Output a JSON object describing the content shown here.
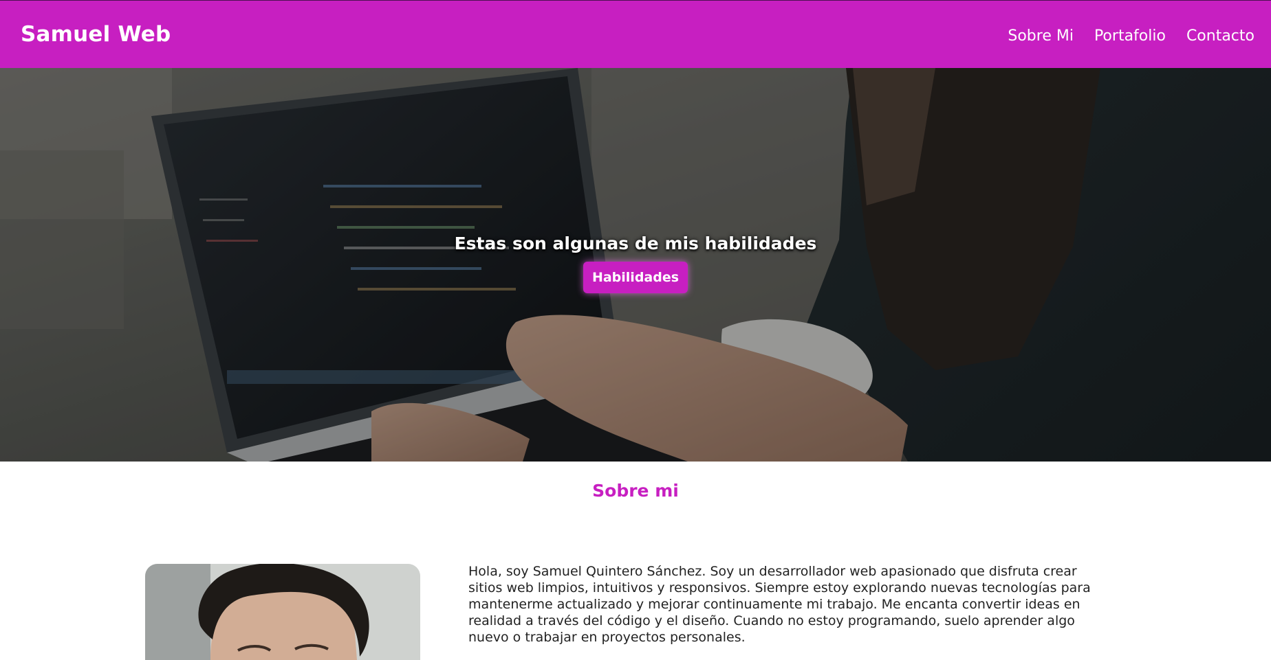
{
  "header": {
    "brand": "Samuel Web",
    "nav": [
      {
        "label": "Sobre Mi"
      },
      {
        "label": "Portafolio"
      },
      {
        "label": "Contacto"
      }
    ]
  },
  "hero": {
    "title": "Estas son algunas de mis habilidades",
    "button_label": "Habilidades"
  },
  "about": {
    "title": "Sobre mi",
    "text": "Hola, soy Samuel Quintero Sánchez. Soy un desarrollador web apasionado que disfruta crear sitios web limpios, intuitivos y responsivos. Siempre estoy explorando nuevas tecnologías para mantenerme actualizado y mejorar continuamente mi trabajo. Me encanta convertir ideas en realidad a través del código y el diseño. Cuando no estoy programando, suelo aprender algo nuevo o trabajar en proyectos personales."
  },
  "colors": {
    "accent": "#c71fc1",
    "text": "#222222",
    "white": "#ffffff"
  }
}
